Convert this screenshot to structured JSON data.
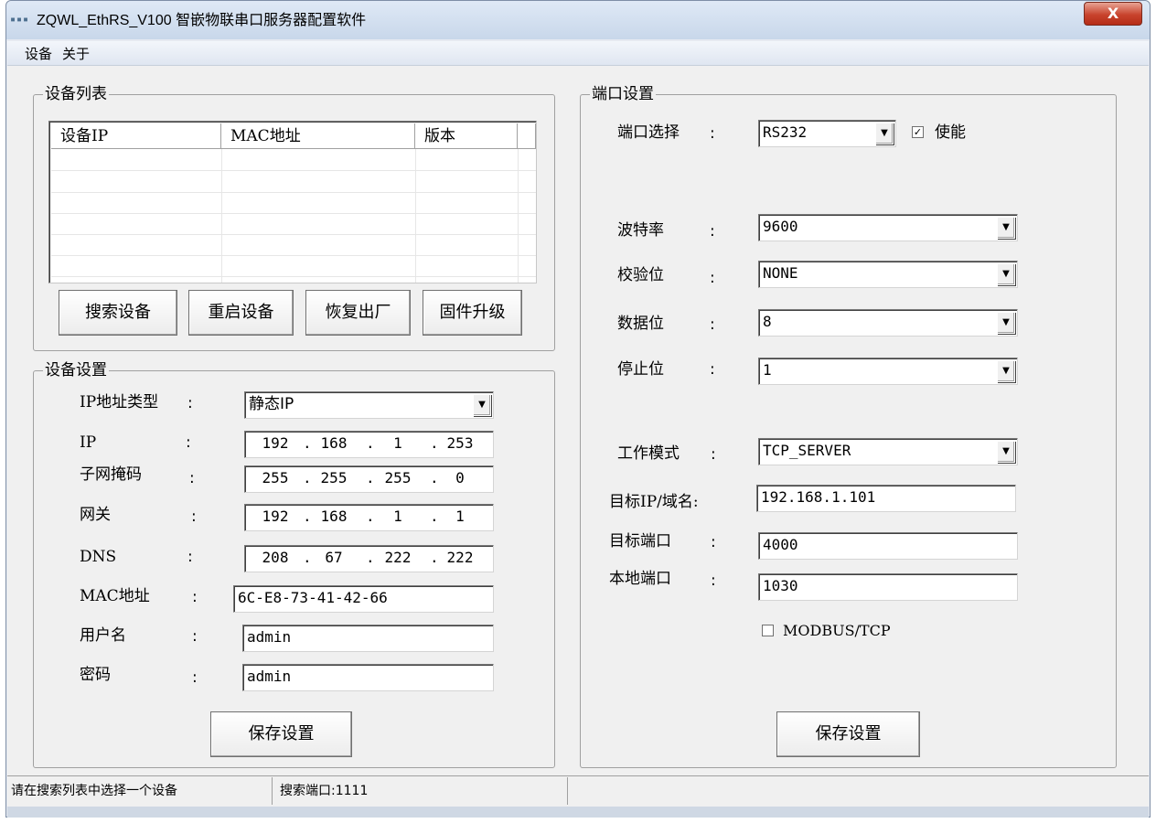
{
  "window": {
    "title": "ZQWL_EthRS_V100  智嵌物联串口服务器配置软件",
    "close_label": "X"
  },
  "menu": [
    "设备",
    "关于"
  ],
  "device_list": {
    "title": "设备列表",
    "columns": [
      "设备IP",
      "MAC地址",
      "版本"
    ],
    "rows": []
  },
  "list_buttons": {
    "search": "搜索设备",
    "restart": "重启设备",
    "restore": "恢复出厂",
    "upgrade": "固件升级"
  },
  "device_settings": {
    "title": "设备设置",
    "ip_type_label": "IP地址类型",
    "ip_type_value": "静态IP",
    "ip_label": "IP",
    "ip": [
      "192",
      "168",
      "1",
      "253"
    ],
    "mask_label": "子网掩码",
    "mask": [
      "255",
      "255",
      "255",
      "0"
    ],
    "gateway_label": "网关",
    "gateway": [
      "192",
      "168",
      "1",
      "1"
    ],
    "dns_label": "DNS",
    "dns": [
      "208",
      "67",
      "222",
      "222"
    ],
    "mac_label": "MAC地址",
    "mac_value": "6C-E8-73-41-42-66",
    "username_label": "用户名",
    "username_value": "admin",
    "password_label": "密码",
    "password_value": "admin",
    "save_label": "保存设置"
  },
  "port_settings": {
    "title": "端口设置",
    "port_label": "端口选择",
    "port_value": "RS232",
    "enable_label": "使能",
    "enable_checked": true,
    "baud_label": "波特率",
    "baud_value": "9600",
    "parity_label": "校验位",
    "parity_value": "NONE",
    "databits_label": "数据位",
    "databits_value": "8",
    "stopbits_label": "停止位",
    "stopbits_value": "1",
    "mode_label": "工作模式",
    "mode_value": "TCP_SERVER",
    "target_ip_label": "目标IP/域名:",
    "target_ip_value": "192.168.1.101",
    "target_port_label": "目标端口",
    "target_port_value": "4000",
    "local_port_label": "本地端口",
    "local_port_value": "1030",
    "modbus_label": "MODBUS/TCP",
    "modbus_checked": false,
    "save_label": "保存设置"
  },
  "colon": ":",
  "status": {
    "message": "请在搜索列表中选择一个设备",
    "search_port": "搜索端口:1111"
  },
  "icons": {
    "dropdown": "▼",
    "check": "✓"
  }
}
